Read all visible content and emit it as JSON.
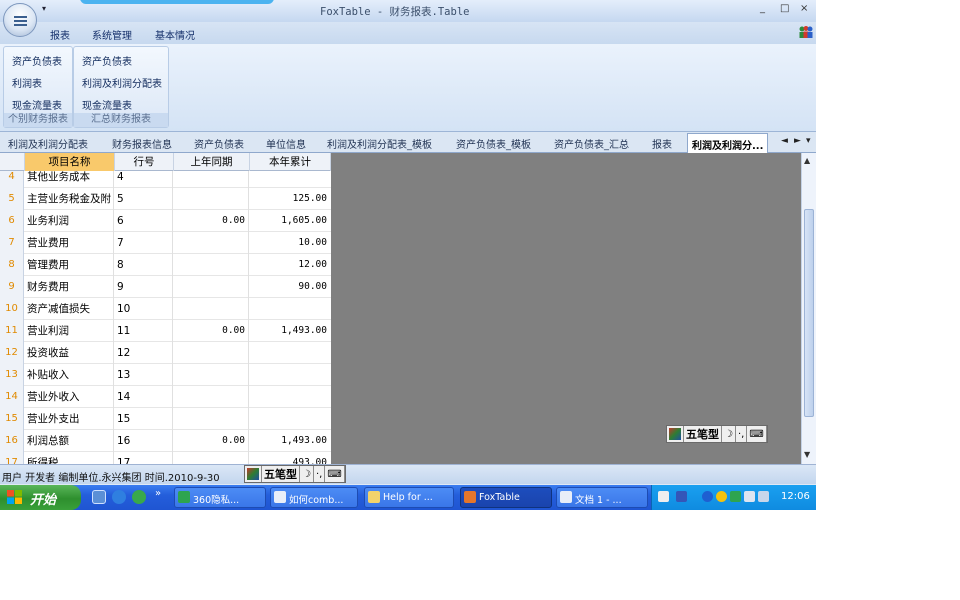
{
  "window": {
    "title": "FoxTable - 财务报表.Table",
    "min": "_",
    "max": "□",
    "close": "×"
  },
  "menu": {
    "items": [
      "报表",
      "系统管理",
      "基本情况"
    ]
  },
  "ribbon": {
    "groups": [
      {
        "title": "个别财务报表",
        "buttons": [
          "资产负债表",
          "利润表",
          "现金流量表"
        ]
      },
      {
        "title": "汇总财务报表",
        "buttons": [
          "资产负债表",
          "利润及利润分配表",
          "现金流量表"
        ]
      }
    ]
  },
  "tabs": {
    "items": [
      "利润及利润分配表",
      "财务报表信息",
      "资产负债表",
      "单位信息",
      "利润及利润分配表_模板",
      "资产负债表_模板",
      "资产负债表_汇总",
      "报表",
      "利润及利润分..."
    ],
    "active_index": 8,
    "nav_prev": "◄",
    "nav_next": "►",
    "nav_menu": "▾"
  },
  "grid": {
    "columns": [
      "项目名称",
      "行号",
      "上年同期",
      "本年累计"
    ],
    "rows": [
      {
        "n": "4",
        "name": "其他业务成本",
        "line": "4",
        "prev": "",
        "cur": ""
      },
      {
        "n": "5",
        "name": "主营业务税金及附",
        "line": "5",
        "prev": "",
        "cur": "125.00"
      },
      {
        "n": "6",
        "name": "业务利润",
        "line": "6",
        "prev": "0.00",
        "cur": "1,605.00"
      },
      {
        "n": "7",
        "name": "营业费用",
        "line": "7",
        "prev": "",
        "cur": "10.00"
      },
      {
        "n": "8",
        "name": "管理费用",
        "line": "8",
        "prev": "",
        "cur": "12.00"
      },
      {
        "n": "9",
        "name": "财务费用",
        "line": "9",
        "prev": "",
        "cur": "90.00"
      },
      {
        "n": "10",
        "name": "资产减值损失",
        "line": "10",
        "prev": "",
        "cur": ""
      },
      {
        "n": "11",
        "name": "营业利润",
        "line": "11",
        "prev": "0.00",
        "cur": "1,493.00"
      },
      {
        "n": "12",
        "name": "投资收益",
        "line": "12",
        "prev": "",
        "cur": ""
      },
      {
        "n": "13",
        "name": "补贴收入",
        "line": "13",
        "prev": "",
        "cur": ""
      },
      {
        "n": "14",
        "name": "营业外收入",
        "line": "14",
        "prev": "",
        "cur": ""
      },
      {
        "n": "15",
        "name": "营业外支出",
        "line": "15",
        "prev": "",
        "cur": ""
      },
      {
        "n": "16",
        "name": "利润总额",
        "line": "16",
        "prev": "0.00",
        "cur": "1,493.00"
      },
      {
        "n": "17",
        "name": "所得税",
        "line": "17",
        "prev": "",
        "cur": "493.00"
      }
    ]
  },
  "ime": {
    "mode": "五笔型",
    "moon": "☽",
    "punct": "·,",
    "keyboard": "⌨"
  },
  "status": {
    "text": "用户  开发者  编制单位.永兴集团 时间.2010-9-30"
  },
  "taskbar": {
    "start": "开始",
    "more": "»",
    "tasks": [
      "360隐私...",
      "如何comb...",
      "Help for ...",
      "FoxTable",
      "文档 1 - ..."
    ],
    "active_index": 3,
    "clock": "12:06"
  },
  "colors": {
    "grey_area": "#808080",
    "row_number": "#e08a00",
    "header_selected": "#f9c96b",
    "taskbar": "#245edb",
    "start_button": "#2e8f2e"
  }
}
